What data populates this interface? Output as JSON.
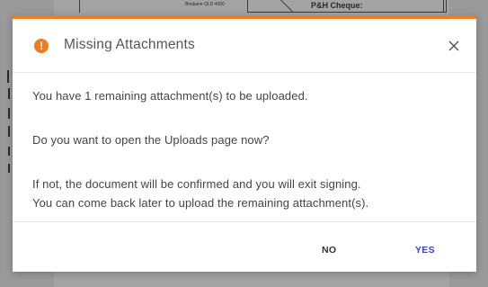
{
  "background": {
    "small_text": "Brisbane QLD 4000",
    "cheque_label": "P&H Cheque:"
  },
  "dialog": {
    "accent_color": "#f07c22",
    "icon": "warning-icon",
    "icon_glyph": "!",
    "title": "Missing Attachments",
    "close_icon": "close-icon",
    "body": {
      "line1": "You have 1 remaining attachment(s) to be uploaded.",
      "line2": "Do you want to open the Uploads page now?",
      "line3": "If not, the document will be confirmed and you will exit signing.",
      "line4": "You can come back later to upload the remaining attachment(s)."
    },
    "buttons": {
      "no_label": "NO",
      "yes_label": "YES",
      "yes_color": "#3a3fc8"
    }
  }
}
